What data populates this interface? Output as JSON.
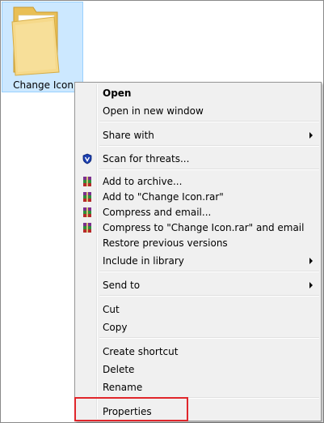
{
  "folder": {
    "label": "Change Icon"
  },
  "menu": {
    "items": [
      {
        "label": "Open",
        "bold": true
      },
      {
        "label": "Open in new window"
      },
      {
        "label": "Share with",
        "submenu": true
      },
      {
        "label": "Scan for threats...",
        "icon": "shield-icon"
      },
      {
        "label": "Add to archive...",
        "icon": "winrar-icon"
      },
      {
        "label": "Add to \"Change Icon.rar\"",
        "icon": "winrar-icon"
      },
      {
        "label": "Compress and email...",
        "icon": "winrar-icon"
      },
      {
        "label": "Compress to \"Change Icon.rar\" and email",
        "icon": "winrar-icon"
      },
      {
        "label": "Restore previous versions"
      },
      {
        "label": "Include in library",
        "submenu": true
      },
      {
        "label": "Send to",
        "submenu": true
      },
      {
        "label": "Cut"
      },
      {
        "label": "Copy"
      },
      {
        "label": "Create shortcut"
      },
      {
        "label": "Delete"
      },
      {
        "label": "Rename"
      },
      {
        "label": "Properties"
      }
    ]
  },
  "colors": {
    "selection": "#cce8ff",
    "menu_bg": "#f0f0f0",
    "highlight_box": "#e0262b",
    "folder_yellow": "#f4d57a"
  }
}
